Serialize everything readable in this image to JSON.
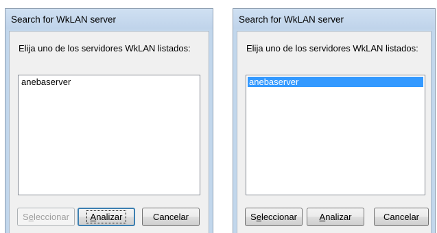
{
  "dialogs": [
    {
      "title": "Search for WkLAN server",
      "prompt": "Elija uno de los servidores WkLAN listados:",
      "server_list": [
        "anebaserver"
      ],
      "selected_index": null,
      "buttons": {
        "select": {
          "pre": "S",
          "accel": "e",
          "post": "leccionar",
          "enabled": false
        },
        "scan": {
          "pre": "",
          "accel": "A",
          "post": "nalizar",
          "enabled": true,
          "default": true
        },
        "cancel": {
          "label": "Cancelar",
          "enabled": true
        }
      }
    },
    {
      "title": "Search for WkLAN server",
      "prompt": "Elija uno de los servidores WkLAN listados:",
      "server_list": [
        "anebaserver"
      ],
      "selected_index": 0,
      "buttons": {
        "select": {
          "pre": "S",
          "accel": "e",
          "post": "leccionar",
          "enabled": true
        },
        "scan": {
          "pre": "",
          "accel": "A",
          "post": "nalizar",
          "enabled": true,
          "default": false
        },
        "cancel": {
          "label": "Cancelar",
          "enabled": true
        }
      }
    }
  ],
  "colors": {
    "title_bar": "#c2d7ec",
    "selection": "#3399ff",
    "disabled_text": "#a0a0a0"
  }
}
